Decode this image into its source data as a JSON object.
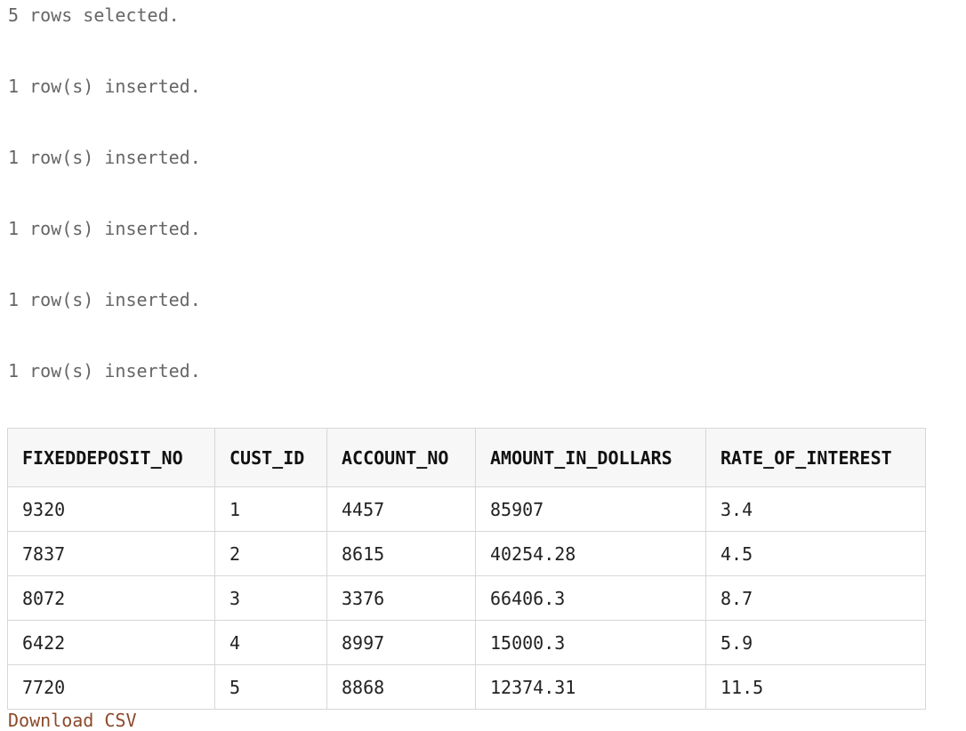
{
  "messages": [
    "5 rows selected.",
    "1 row(s) inserted.",
    "1 row(s) inserted.",
    "1 row(s) inserted.",
    "1 row(s) inserted.",
    "1 row(s) inserted."
  ],
  "table": {
    "headers": [
      "FIXEDDEPOSIT_NO",
      "CUST_ID",
      "ACCOUNT_NO",
      "AMOUNT_IN_DOLLARS",
      "RATE_OF_INTEREST"
    ],
    "rows": [
      [
        "9320",
        "1",
        "4457",
        "85907",
        "3.4"
      ],
      [
        "7837",
        "2",
        "8615",
        "40254.28",
        "4.5"
      ],
      [
        "8072",
        "3",
        "3376",
        "66406.3",
        "8.7"
      ],
      [
        "6422",
        "4",
        "8997",
        "15000.3",
        "5.9"
      ],
      [
        "7720",
        "5",
        "8868",
        "12374.31",
        "11.5"
      ]
    ]
  },
  "download": {
    "label": "Download CSV"
  }
}
